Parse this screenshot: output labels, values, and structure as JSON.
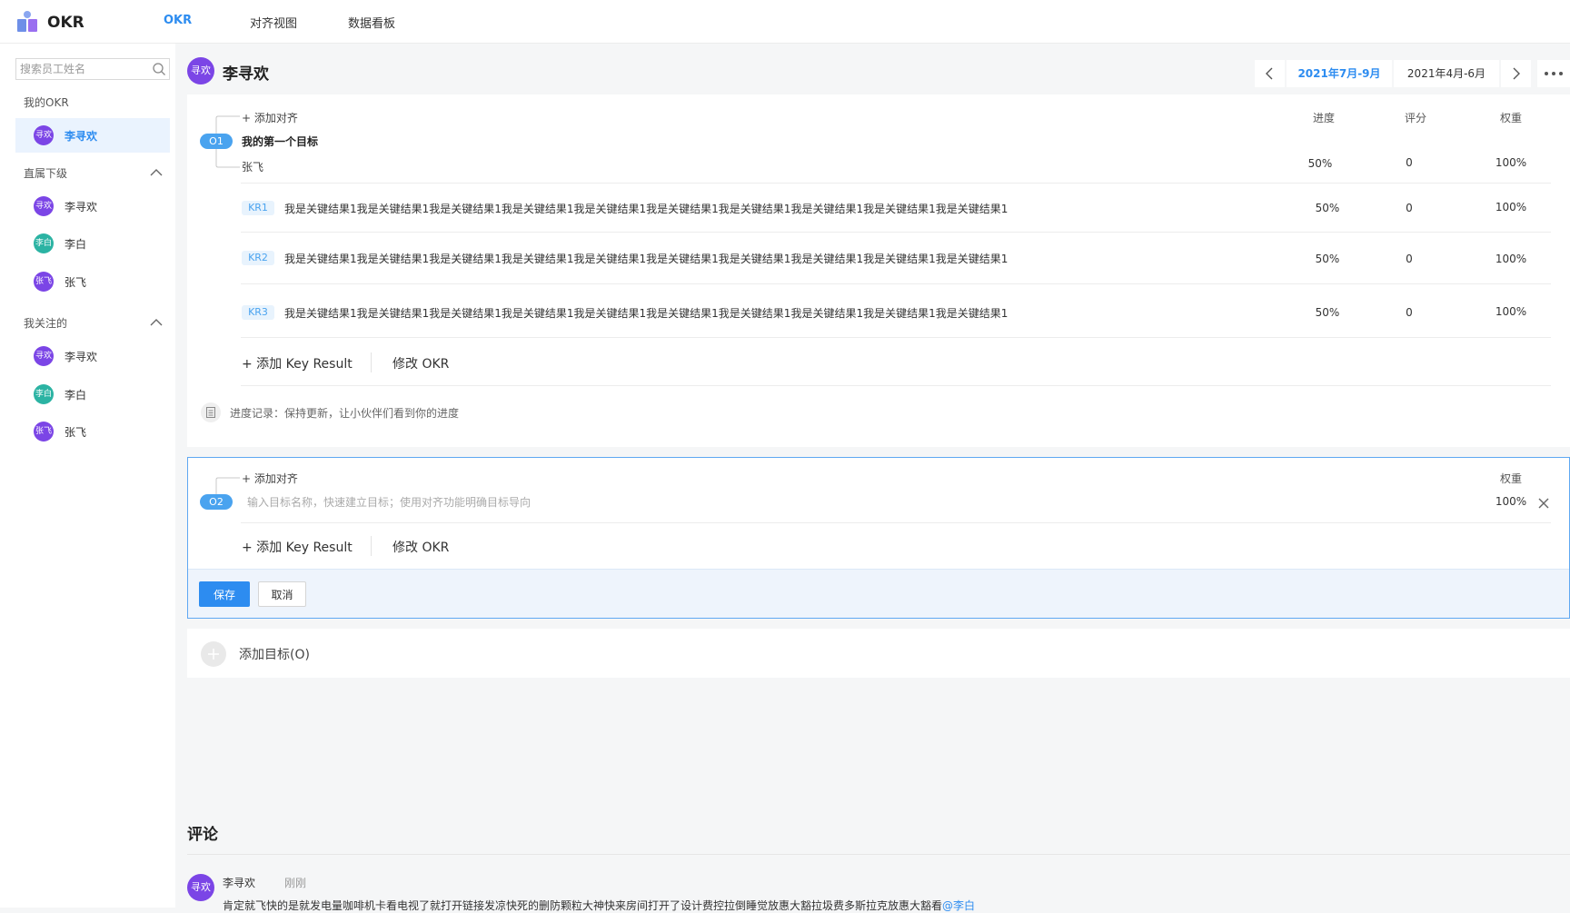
{
  "app": {
    "title": "OKR"
  },
  "nav": {
    "tabs": [
      "OKR",
      "对齐视图",
      "数据看板"
    ],
    "active": 0
  },
  "sidebar": {
    "search_placeholder": "搜索员工姓名",
    "my_okr_label": "我的OKR",
    "me": {
      "avatar": "寻欢",
      "name": "李寻欢"
    },
    "direct_reports": {
      "label": "直属下级",
      "items": [
        {
          "avatar": "寻欢",
          "name": "李寻欢"
        },
        {
          "avatar": "李白",
          "name": "李白"
        },
        {
          "avatar": "张飞",
          "name": "张飞"
        }
      ]
    },
    "following": {
      "label": "我关注的",
      "items": [
        {
          "avatar": "寻欢",
          "name": "李寻欢"
        },
        {
          "avatar": "李白",
          "name": "李白"
        },
        {
          "avatar": "张飞",
          "name": "张飞"
        }
      ]
    }
  },
  "header": {
    "avatar": "寻欢",
    "name": "李寻欢",
    "periods": [
      "2021年7月-9月",
      "2021年4月-6月"
    ],
    "active_period": 0
  },
  "columns": {
    "progress": "进度",
    "score": "评分",
    "weight": "权重"
  },
  "objective1": {
    "add_align": "+ 添加对齐",
    "badge": "O1",
    "title": "我的第一个目标",
    "aligned_to": "张飞",
    "progress": "50%",
    "score": "0",
    "weight": "100%",
    "key_results": [
      {
        "badge": "KR1",
        "text": "我是关键结果1我是关键结果1我是关键结果1我是关键结果1我是关键结果1我是关键结果1我是关键结果1我是关键结果1我是关键结果1我是关键结果1",
        "progress": "50%",
        "score": "0",
        "weight": "100%"
      },
      {
        "badge": "KR2",
        "text": "我是关键结果1我是关键结果1我是关键结果1我是关键结果1我是关键结果1我是关键结果1我是关键结果1我是关键结果1我是关键结果1我是关键结果1",
        "progress": "50%",
        "score": "0",
        "weight": "100%"
      },
      {
        "badge": "KR3",
        "text": "我是关键结果1我是关键结果1我是关键结果1我是关键结果1我是关键结果1我是关键结果1我是关键结果1我是关键结果1我是关键结果1我是关键结果1",
        "progress": "50%",
        "score": "0",
        "weight": "100%"
      }
    ],
    "add_kr": "+ 添加 Key Result",
    "edit_okr": "修改 OKR",
    "progress_note": "进度记录：保持更新，让小伙伴们看到你的进度"
  },
  "objective2": {
    "add_align": "+ 添加对齐",
    "badge": "O2",
    "input_value": "",
    "input_placeholder": "输入目标名称，快速建立目标；使用对齐功能明确目标导向",
    "weight_label": "权重",
    "weight": "100%",
    "add_kr": "+ 添加 Key Result",
    "edit_okr": "修改 OKR",
    "save": "保存",
    "cancel": "取消"
  },
  "add_objective": "添加目标(O)",
  "comments": {
    "title": "评论",
    "items": [
      {
        "avatar": "寻欢",
        "author": "李寻欢",
        "time": "刚刚",
        "text": "肯定就飞快的是就发电量咖啡机卡看电视了就打开链接发凉快死的删防颗粒大神快来房间打开了设计费控拉倒睡觉放惠大豁拉圾费多斯拉克放惠大豁看",
        "mention": "@李白"
      }
    ]
  },
  "colors": {
    "accent": "#2d8cf0",
    "avatar_purple": "#7b45e6",
    "avatar_teal": "#2bb3a3",
    "badge_blue": "#4aa3ef"
  },
  "icons": [
    "okr-logo-icon",
    "search-icon",
    "chevron-up-icon",
    "chevron-left-icon",
    "chevron-right-icon",
    "more-icon",
    "document-icon",
    "close-icon",
    "plus-icon"
  ]
}
